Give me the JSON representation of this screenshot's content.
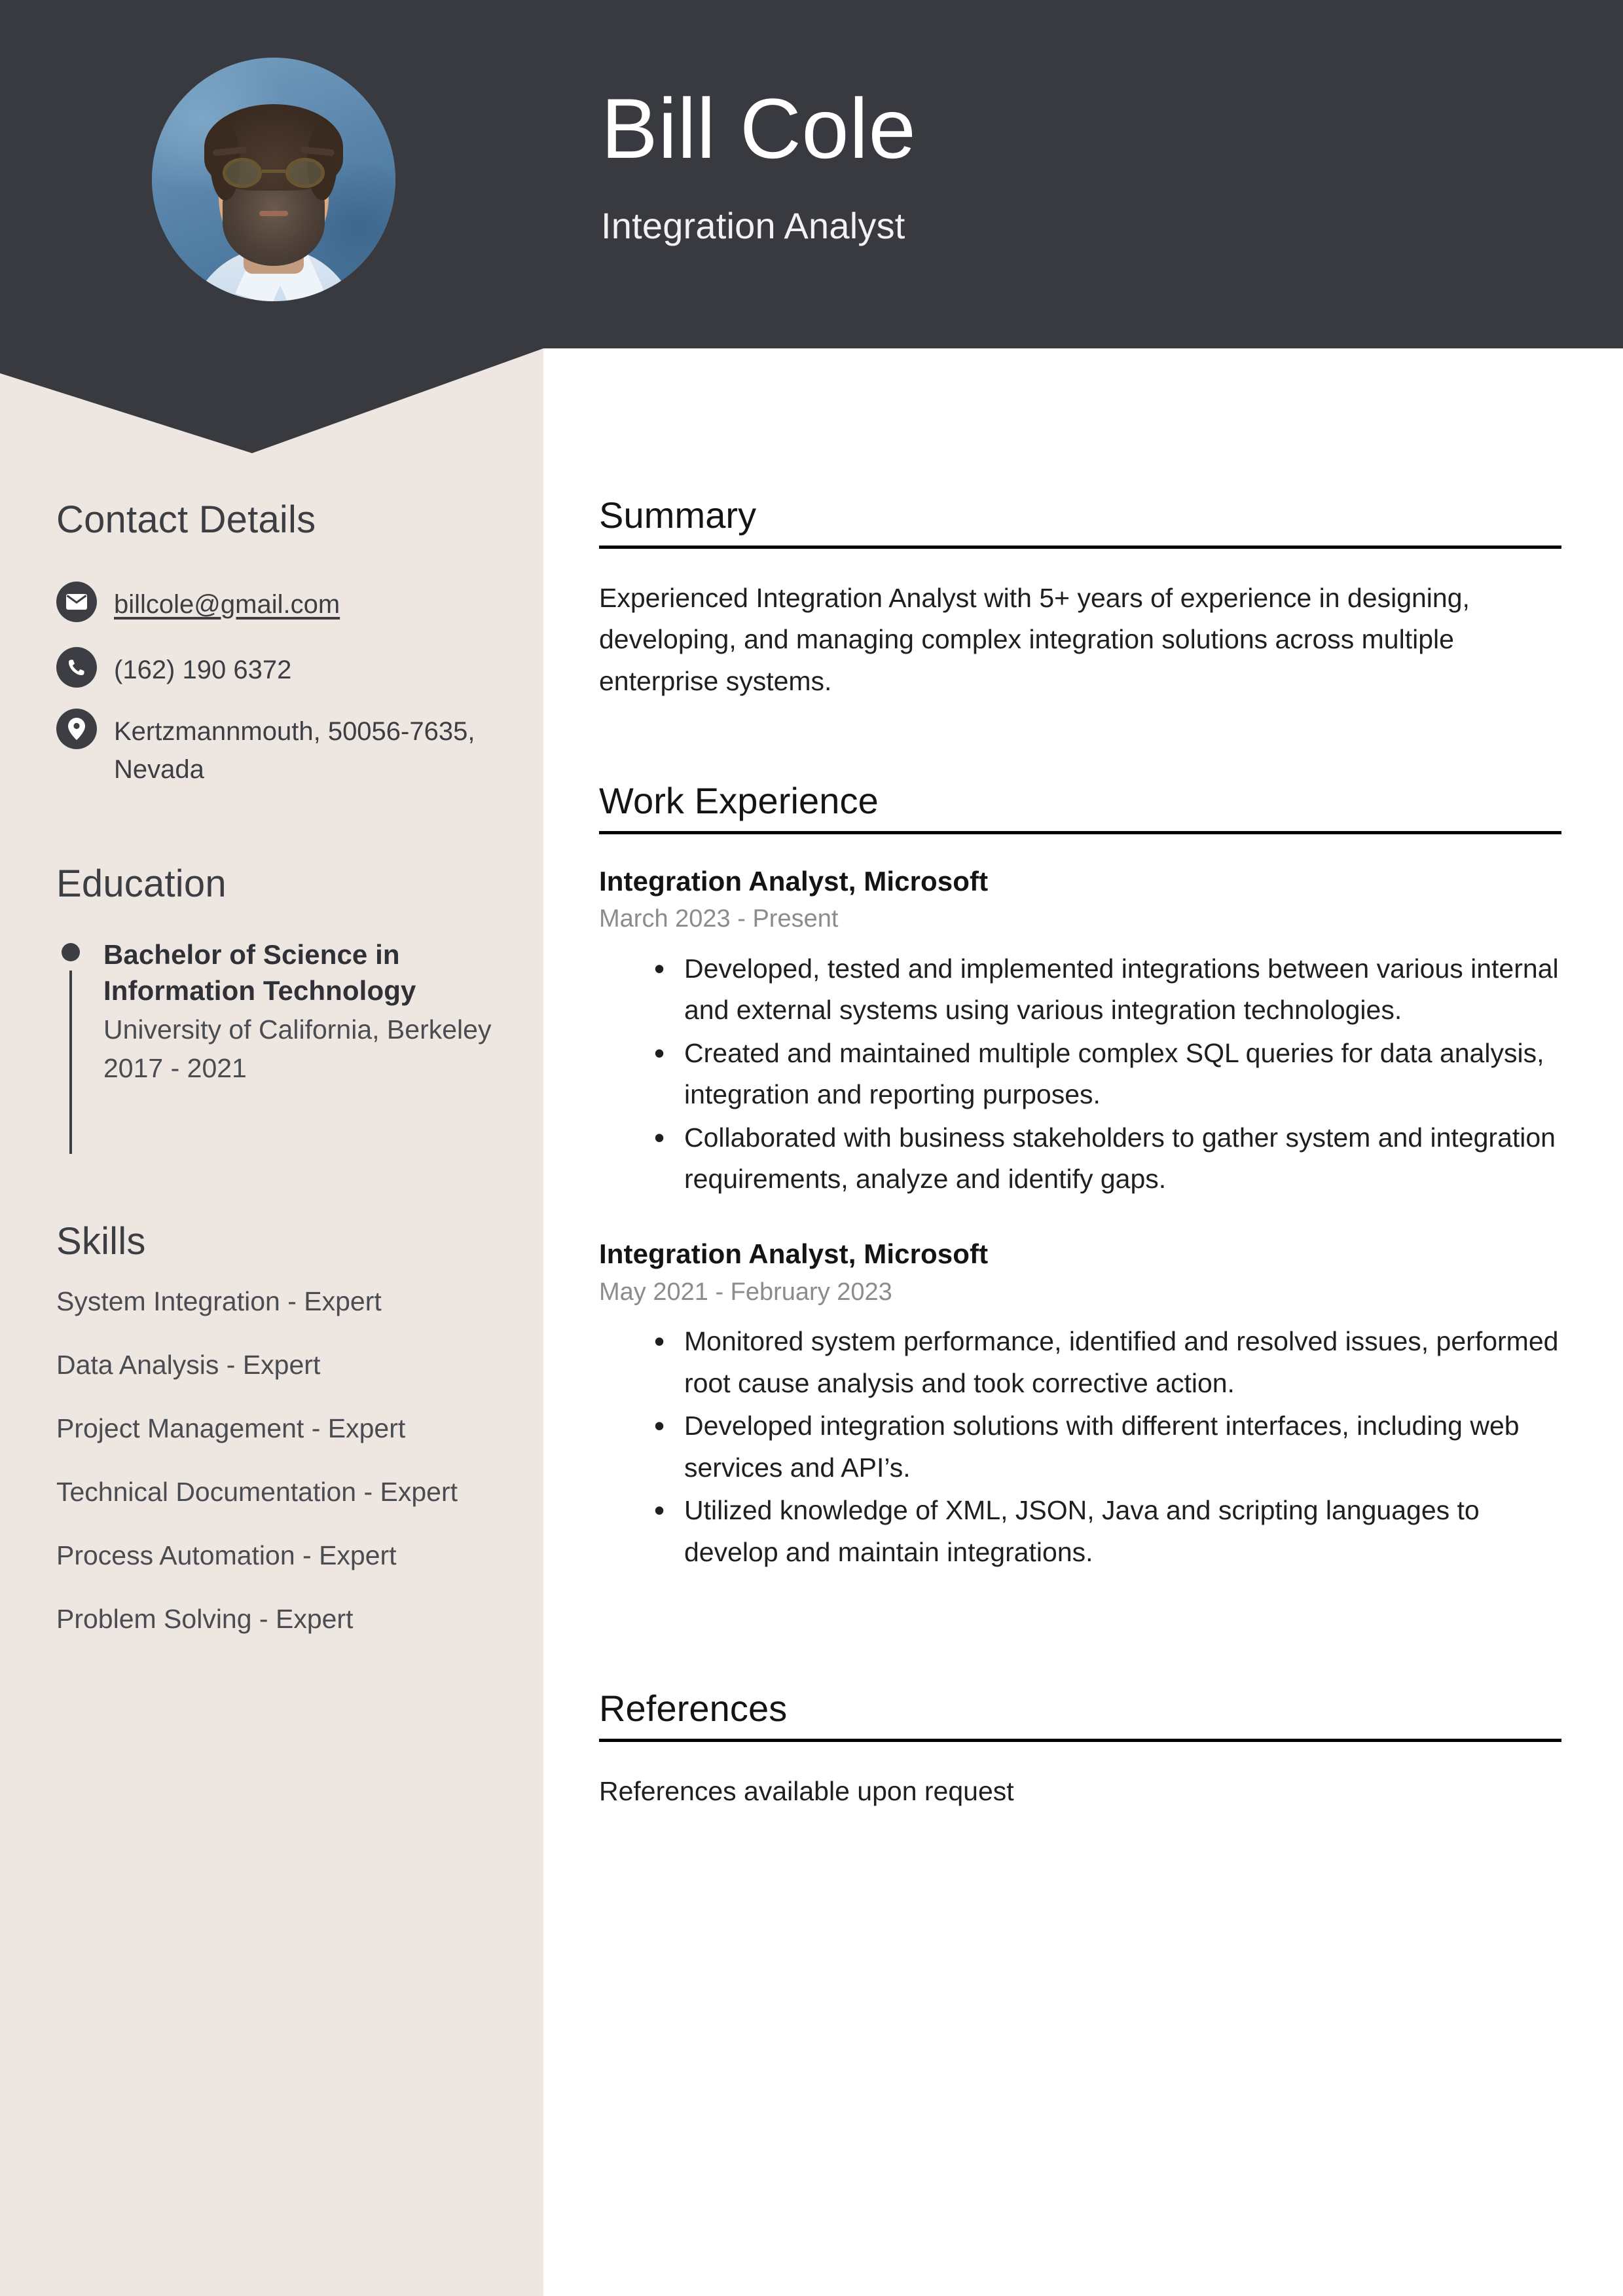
{
  "colors": {
    "header_bg": "#383A3F",
    "sidebar_bg": "#EEE6E1",
    "page_bg": "#FFFFFF",
    "heading_text": "#141414",
    "body_text": "#1F1F1F",
    "muted_text": "#8C8C8C",
    "sidebar_text": "#4A4C51"
  },
  "header": {
    "name": "Bill Cole",
    "job_title": "Integration Analyst",
    "avatar_alt": "Portrait photo of Bill Cole"
  },
  "sidebar": {
    "contact": {
      "heading": "Contact Details",
      "items": [
        {
          "icon": "envelope-icon",
          "value": "billcole@gmail.com",
          "is_link": true
        },
        {
          "icon": "phone-icon",
          "value": "(162) 190 6372",
          "is_link": false
        },
        {
          "icon": "location-pin-icon",
          "value": "Kertzmannmouth, 50056-7635, Nevada",
          "is_link": false
        }
      ]
    },
    "education": {
      "heading": "Education",
      "items": [
        {
          "degree": "Bachelor of Science in Information Technology",
          "school": "University of California, Berkeley",
          "dates": "2017 - 2021"
        }
      ]
    },
    "skills": {
      "heading": "Skills",
      "items": [
        "System Integration - Expert",
        "Data Analysis - Expert",
        "Project Management - Expert",
        "Technical Documentation - Expert",
        "Process Automation - Expert",
        "Problem Solving - Expert"
      ]
    }
  },
  "main": {
    "summary": {
      "heading": "Summary",
      "text": "Experienced Integration Analyst with 5+ years of experience in designing, developing, and managing complex integration solutions across multiple enterprise systems."
    },
    "work_experience": {
      "heading": "Work Experience",
      "jobs": [
        {
          "title": "Integration Analyst, Microsoft",
          "dates": "March 2023 - Present",
          "bullets": [
            "Developed, tested and implemented integrations between various internal and external systems using various integration technologies.",
            "Created and maintained multiple complex SQL queries for data analysis, integration and reporting purposes.",
            "Collaborated with business stakeholders to gather system and integration requirements, analyze and identify gaps."
          ]
        },
        {
          "title": "Integration Analyst, Microsoft",
          "dates": "May 2021 - February 2023",
          "bullets": [
            "Monitored system performance, identified and resolved issues, performed root cause analysis and took corrective action.",
            "Developed integration solutions with different interfaces, including web services and API’s.",
            "Utilized knowledge of XML, JSON, Java and scripting languages to develop and maintain integrations."
          ]
        }
      ]
    },
    "references": {
      "heading": "References",
      "text": "References available upon request"
    }
  }
}
